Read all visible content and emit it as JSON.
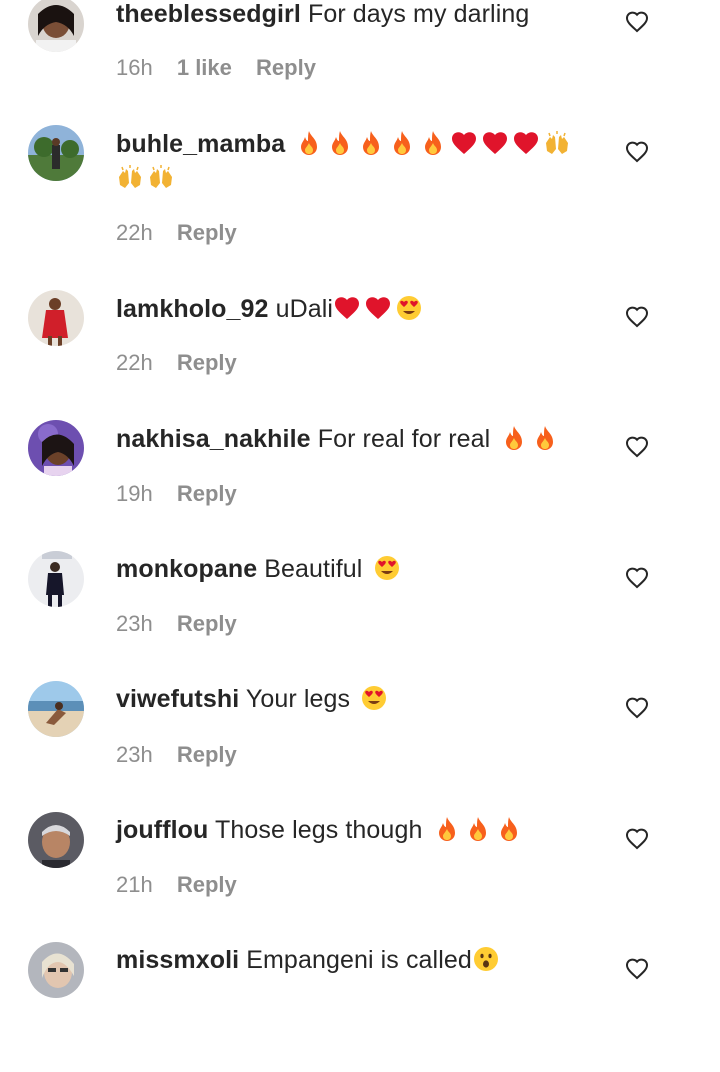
{
  "comments": [
    {
      "username": "theeblessedgirl",
      "text": "For days my darling",
      "emojis": [],
      "time": "16h",
      "likes": "1 like",
      "reply": "Reply",
      "avatar_icon": "avatar-photo"
    },
    {
      "username": "buhle_mamba",
      "text": "",
      "emojis": [
        "fire",
        "fire",
        "fire",
        "fire",
        "fire",
        "heart",
        "heart",
        "heart",
        "raised-hands",
        "raised-hands",
        "raised-hands"
      ],
      "time": "22h",
      "likes": "",
      "reply": "Reply",
      "avatar_icon": "avatar-photo"
    },
    {
      "username": "lamkholo_92",
      "text": "uDali",
      "emojis": [
        "heart",
        "heart",
        "heart-eyes"
      ],
      "time": "22h",
      "likes": "",
      "reply": "Reply",
      "avatar_icon": "avatar-photo"
    },
    {
      "username": "nakhisa_nakhile",
      "text": "For real for real",
      "emojis": [
        "fire",
        "fire"
      ],
      "time": "19h",
      "likes": "",
      "reply": "Reply",
      "avatar_icon": "avatar-photo"
    },
    {
      "username": "monkopane",
      "text": "Beautiful",
      "emojis": [
        "heart-eyes"
      ],
      "time": "23h",
      "likes": "",
      "reply": "Reply",
      "avatar_icon": "avatar-photo"
    },
    {
      "username": "viwefutshi",
      "text": "Your legs",
      "emojis": [
        "heart-eyes"
      ],
      "time": "23h",
      "likes": "",
      "reply": "Reply",
      "avatar_icon": "avatar-photo"
    },
    {
      "username": "joufflou",
      "text": "Those legs though",
      "emojis": [
        "fire",
        "fire",
        "fire"
      ],
      "time": "21h",
      "likes": "",
      "reply": "Reply",
      "avatar_icon": "avatar-photo"
    },
    {
      "username": "missmxoli",
      "text": "Empangeni is called",
      "emojis": [
        "hushed"
      ],
      "time": "",
      "likes": "",
      "reply": "",
      "avatar_icon": "avatar-photo"
    }
  ],
  "like_icon": "heart-outline-icon",
  "colors": {
    "text": "#262626",
    "meta": "#8e8e8e",
    "fire": "#f7601c",
    "heart": "#e0142b",
    "face": "#ffcc33"
  }
}
